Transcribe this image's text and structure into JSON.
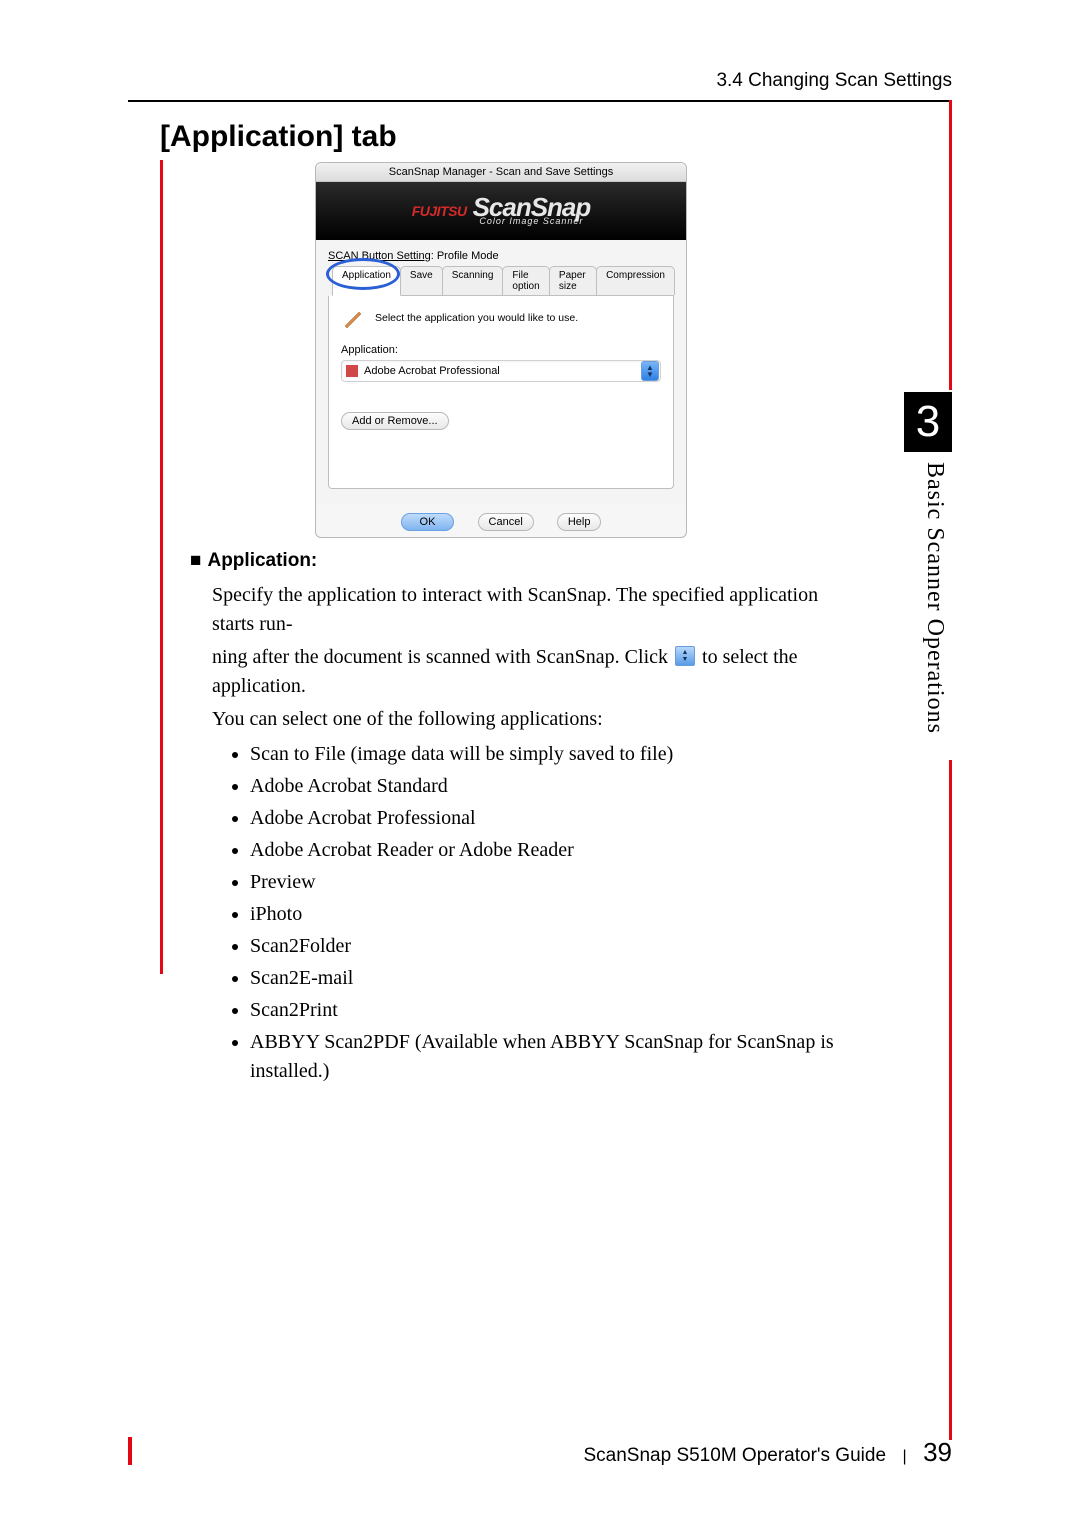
{
  "header": {
    "section": "3.4 Changing Scan Settings"
  },
  "heading": "[Application] tab",
  "dialog": {
    "title": "ScanSnap Manager - Scan and Save Settings",
    "brand_small": "FUJITSU",
    "brand_main": "ScanSnap",
    "brand_sub": "Color Image Scanner",
    "mode_label_a": "SCAN Button Setting",
    "mode_label_b": ": Profile Mode",
    "tabs": [
      "Application",
      "Save",
      "Scanning",
      "File option",
      "Paper size",
      "Compression"
    ],
    "hint": "Select the application you would like to use.",
    "field_label": "Application:",
    "selected_app": "Adobe Acrobat Professional",
    "add_remove": "Add or Remove...",
    "ok": "OK",
    "cancel": "Cancel",
    "help": "Help"
  },
  "body": {
    "subhead": "Application:",
    "p1a": "Specify the application to interact with ScanSnap. The specified application starts run-",
    "p1b_pre": "ning after the document is scanned with ScanSnap. Click ",
    "p1b_post": " to select the application.",
    "p2": "You can select one of the following applications:",
    "apps": [
      "Scan to File (image data will be simply saved to file)",
      "Adobe Acrobat  Standard",
      "Adobe Acrobat  Professional",
      "Adobe Acrobat Reader or Adobe Reader",
      "Preview",
      "iPhoto",
      "Scan2Folder",
      "Scan2E-mail",
      "Scan2Print",
      "ABBYY Scan2PDF (Available when ABBYY ScanSnap for ScanSnap is installed.)"
    ]
  },
  "chapter": {
    "num": "3",
    "title": "Basic Scanner Operations"
  },
  "footer": {
    "guide": "ScanSnap  S510M Operator's Guide",
    "sep": "|",
    "page": "39"
  }
}
